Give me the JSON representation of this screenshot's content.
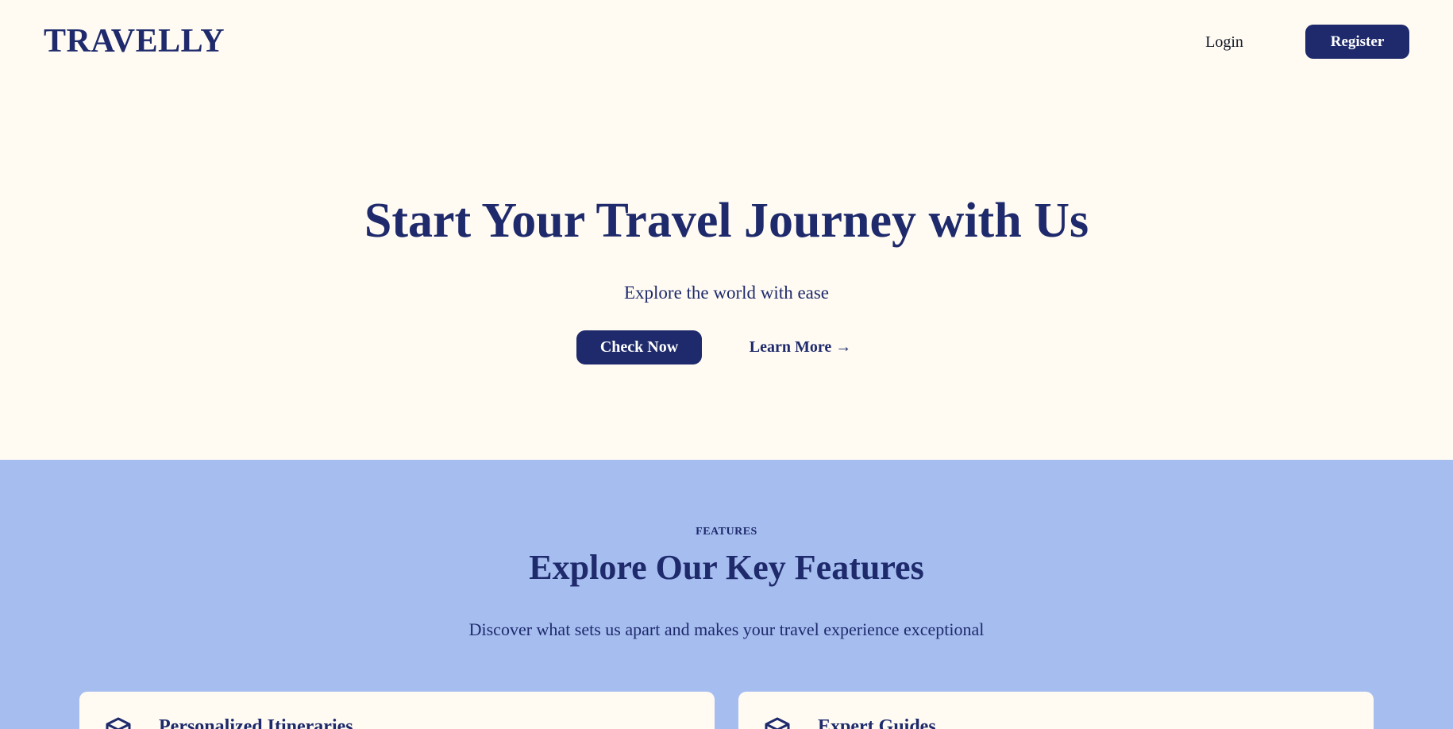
{
  "header": {
    "logo": "TRAVELLY",
    "login_label": "Login",
    "register_label": "Register"
  },
  "hero": {
    "title": "Start Your Travel Journey with Us",
    "subtitle": "Explore the world with ease",
    "primary_button": "Check Now",
    "secondary_link": "Learn More →"
  },
  "features": {
    "eyebrow": "FEATURES",
    "title": "Explore Our Key Features",
    "description": "Discover what sets us apart and makes your travel experience exceptional",
    "cards": [
      {
        "title": "Personalized Itineraries",
        "icon": "cube-icon"
      },
      {
        "title": "Expert Guides",
        "icon": "cube-icon"
      }
    ]
  },
  "colors": {
    "brand_navy": "#1e2a6b",
    "page_background": "#fffbf3",
    "features_background": "#a6bdf0"
  }
}
